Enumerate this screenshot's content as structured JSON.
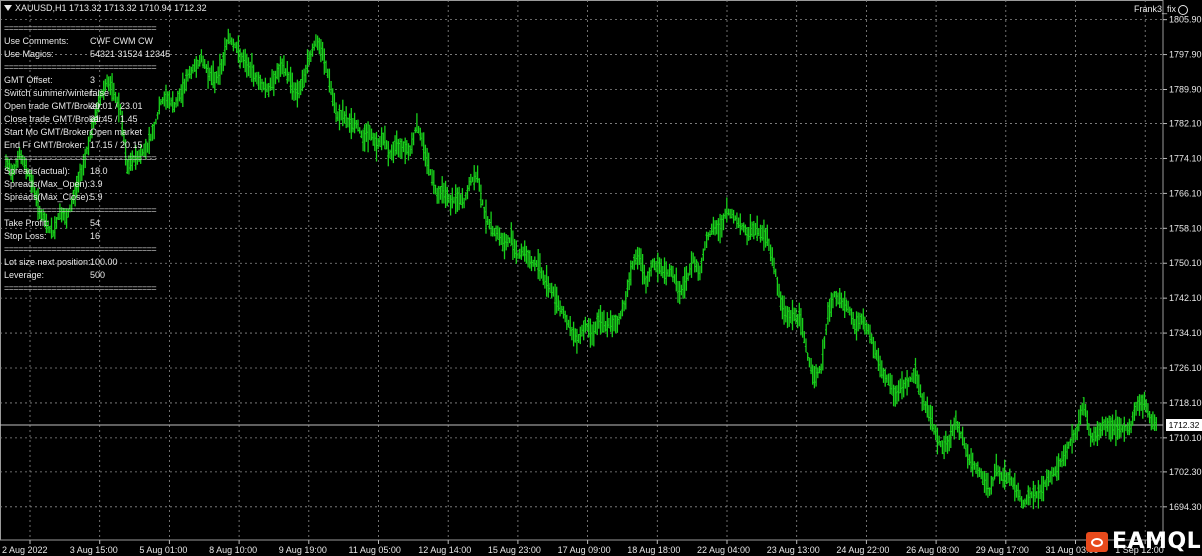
{
  "header": {
    "symbol_line": "XAUUSD,H1  1713.32 1713.32 1710.94 1712.32"
  },
  "ea_name": "Frank3_fix",
  "info_panel": [
    {
      "k": "================================",
      "v": "",
      "sep": true
    },
    {
      "k": "Use Comments:",
      "v": "CWF     CWM     CW"
    },
    {
      "k": "Use Magics:",
      "v": "54321   31524   12345"
    },
    {
      "k": "================================",
      "v": "",
      "sep": true
    },
    {
      "k": "GMT Offset:",
      "v": "3"
    },
    {
      "k": "Switch summer/winter:",
      "v": "false"
    },
    {
      "k": "Open trade GMT/Broker:",
      "v": "20.01 / 23.01"
    },
    {
      "k": "Close trade GMT/Broker:",
      "v": "21.45 / 1.45"
    },
    {
      "k": "Start Mo GMT/Broker:",
      "v": "Open market"
    },
    {
      "k": "End Fr GMT/Broker:",
      "v": "17.15 / 20.15"
    },
    {
      "k": "================================",
      "v": "",
      "sep": true
    },
    {
      "k": "Spreads(actual):",
      "v": "18.0"
    },
    {
      "k": "Spreads(Max_Open):",
      "v": "3.9"
    },
    {
      "k": "Spreads(Max_Close):",
      "v": "5.9"
    },
    {
      "k": "================================",
      "v": "",
      "sep": true
    },
    {
      "k": "Take Profit:",
      "v": "54"
    },
    {
      "k": "Stop Loss:",
      "v": "16"
    },
    {
      "k": "================================",
      "v": "",
      "sep": true
    },
    {
      "k": "Lot size next position:",
      "v": "100.00"
    },
    {
      "k": "Leverage:",
      "v": "500"
    },
    {
      "k": "================================",
      "v": "",
      "sep": true
    }
  ],
  "current_price": "1712.32",
  "logo_text": "EAMQL",
  "colors": {
    "background": "#000000",
    "candle": "#19d11b",
    "grid": "#9a9a9a",
    "text": "#e8e8e8"
  },
  "chart_data": {
    "type": "line",
    "ylim": [
      1686.7,
      1810.4
    ],
    "y_ticks": [
      "1805.90",
      "1797.90",
      "1789.90",
      "1782.10",
      "1774.10",
      "1766.10",
      "1758.10",
      "1750.10",
      "1742.10",
      "1734.10",
      "1726.10",
      "1718.10",
      "1710.10",
      "1702.30",
      "1694.30"
    ],
    "x_ticks": [
      "2 Aug 2022",
      "3 Aug 15:00",
      "5 Aug 01:00",
      "8 Aug 10:00",
      "9 Aug 19:00",
      "11 Aug 05:00",
      "12 Aug 14:00",
      "15 Aug 23:00",
      "17 Aug 09:00",
      "18 Aug 18:00",
      "22 Aug 04:00",
      "23 Aug 13:00",
      "24 Aug 22:00",
      "26 Aug 08:00",
      "29 Aug 17:00",
      "31 Aug 03:00",
      "1 Sep 12:00"
    ],
    "series": [
      {
        "values": [
          1773,
          1771,
          1775,
          1772,
          1768,
          1762,
          1759,
          1757,
          1762,
          1760,
          1765,
          1770,
          1776,
          1782,
          1788,
          1792,
          1789,
          1785,
          1772,
          1774,
          1775,
          1777,
          1781,
          1787,
          1788,
          1786,
          1789,
          1793,
          1795,
          1797,
          1794,
          1792,
          1795,
          1802,
          1800,
          1797,
          1795,
          1793,
          1791,
          1790,
          1793,
          1795,
          1793,
          1789,
          1791,
          1797,
          1801,
          1798,
          1792,
          1784,
          1784,
          1782,
          1782,
          1779,
          1780,
          1777,
          1779,
          1775,
          1777,
          1777,
          1776,
          1782,
          1777,
          1771,
          1766,
          1767,
          1764,
          1765,
          1764,
          1769,
          1770,
          1762,
          1758,
          1757,
          1754,
          1756,
          1752,
          1753,
          1750,
          1750,
          1746,
          1744,
          1741,
          1738,
          1734,
          1733,
          1736,
          1734,
          1737,
          1736,
          1736,
          1737,
          1742,
          1750,
          1752,
          1745,
          1750,
          1749,
          1748,
          1748,
          1743,
          1746,
          1751,
          1748,
          1756,
          1758,
          1758,
          1762,
          1761,
          1759,
          1757,
          1758,
          1757,
          1756,
          1750,
          1741,
          1738,
          1738,
          1737,
          1729,
          1724,
          1726,
          1738,
          1743,
          1741,
          1740,
          1736,
          1737,
          1735,
          1730,
          1725,
          1723,
          1720,
          1722,
          1723,
          1725,
          1719,
          1716,
          1711,
          1708,
          1709,
          1714,
          1710,
          1705,
          1703,
          1701,
          1698,
          1703,
          1701,
          1701,
          1698,
          1695,
          1697,
          1697,
          1699,
          1701,
          1703,
          1706,
          1709,
          1712,
          1718,
          1710,
          1711,
          1713,
          1713,
          1712,
          1712,
          1713,
          1718,
          1718,
          1714,
          1713
        ]
      }
    ]
  }
}
